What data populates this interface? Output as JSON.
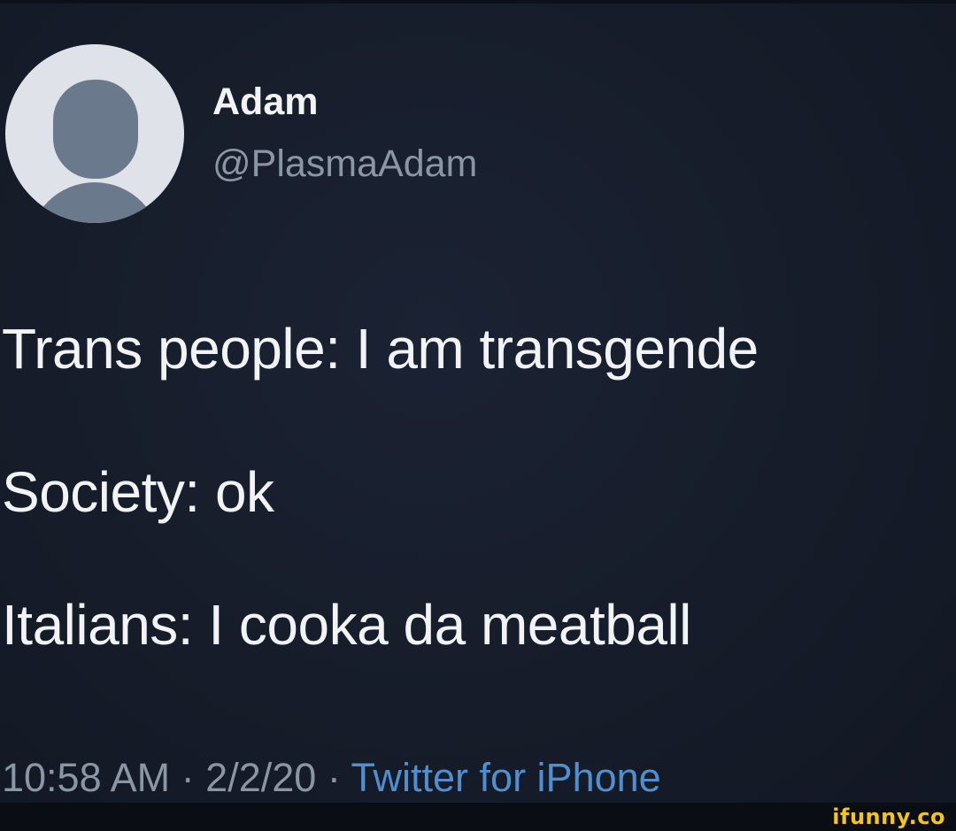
{
  "author": {
    "display_name": "Adam",
    "handle": "@PlasmaAdam",
    "avatar_icon": "default-avatar-icon"
  },
  "tweet": {
    "lines": [
      "Trans people: I am transgende",
      "Society: ok",
      "Italians: I cooka da meatball"
    ]
  },
  "meta": {
    "time": "10:58 AM",
    "separator": "·",
    "date": "2/2/20",
    "client": "Twitter for iPhone"
  },
  "watermark": "ifunny.co",
  "colors": {
    "background": "#161c2a",
    "primary_text": "#f2f3f5",
    "secondary_text": "#8b96a4",
    "link": "#4f8fd0",
    "watermark": "#f5c518"
  }
}
